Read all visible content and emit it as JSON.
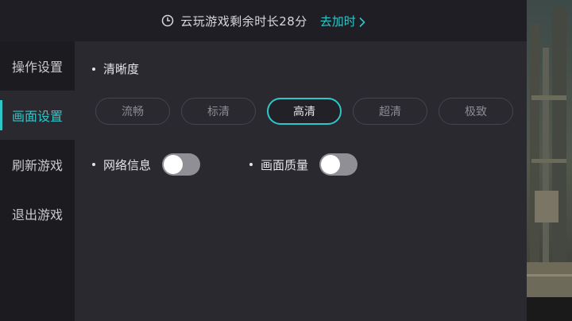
{
  "top_bar": {
    "remaining_text": "云玩游戏剩余时长28分",
    "add_time_label": "去加时"
  },
  "sidebar": {
    "items": [
      {
        "label": "操作设置",
        "active": false
      },
      {
        "label": "画面设置",
        "active": true
      },
      {
        "label": "刷新游戏",
        "active": false
      },
      {
        "label": "退出游戏",
        "active": false
      }
    ]
  },
  "panel": {
    "clarity_title": "清晰度",
    "quality_options": [
      {
        "label": "流畅",
        "selected": false
      },
      {
        "label": "标清",
        "selected": false
      },
      {
        "label": "高清",
        "selected": true
      },
      {
        "label": "超清",
        "selected": false
      },
      {
        "label": "极致",
        "selected": false
      }
    ],
    "toggles": [
      {
        "label": "网络信息",
        "on": false
      },
      {
        "label": "画面质量",
        "on": false
      }
    ]
  },
  "colors": {
    "accent": "#2ec7c9",
    "background": "#1b1b20",
    "panel": "#2a2930"
  }
}
